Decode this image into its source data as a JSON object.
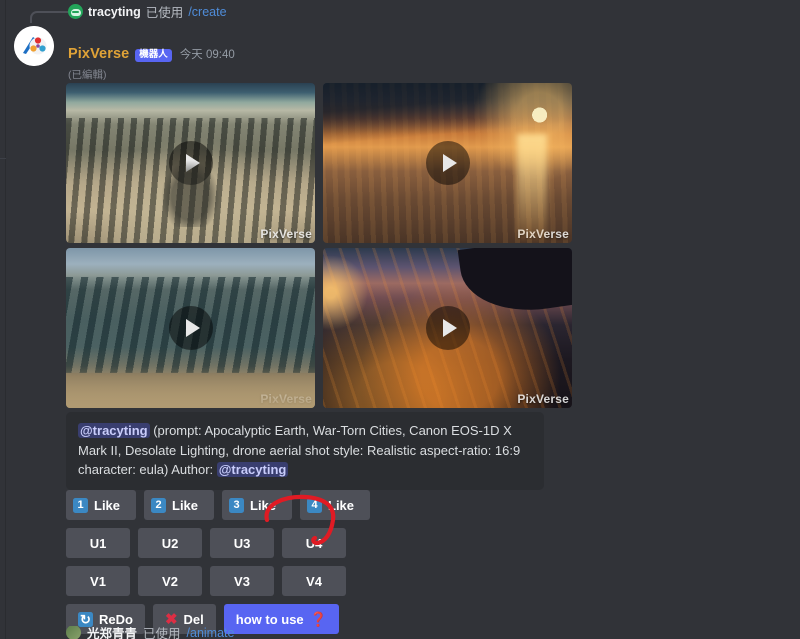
{
  "reply_reference": {
    "avatar_icon": "discord-user-avatar",
    "username": "tracyting",
    "action": "已使用",
    "command": "/create"
  },
  "message": {
    "avatar_icon": "pixverse-logo-avatar",
    "bot_name": "PixVerse",
    "bot_tag": "機器人",
    "timestamp": "今天 09:40",
    "edited_mark": "(已編輯)"
  },
  "media": {
    "play_icon": "play-icon",
    "watermark": "PixVerse",
    "tiles": [
      {
        "alt": "Aerial view of ruined classical city plaza",
        "art": "art1"
      },
      {
        "alt": "Flooded city at fiery orange sunset",
        "art": "art2"
      },
      {
        "alt": "Aerial view of vast destroyed city blocks",
        "art": "art3"
      },
      {
        "alt": "Night aerial of burning city with aircraft wing",
        "art": "art4"
      }
    ]
  },
  "prompt": {
    "mention": "@tracyting",
    "body": " (prompt: Apocalyptic Earth, War-Torn Cities, Canon EOS-1D X Mark II, Desolate Lighting, drone aerial shot style: Realistic aspect-ratio: 16:9 character: eula) Author: ",
    "author_mention": "@tracyting"
  },
  "buttons": {
    "like_row": [
      {
        "badge": "1",
        "label": "Like"
      },
      {
        "badge": "2",
        "label": "Like"
      },
      {
        "badge": "3",
        "label": "Like"
      },
      {
        "badge": "4",
        "label": "Like"
      }
    ],
    "u_row": [
      {
        "label": "U1"
      },
      {
        "label": "U2"
      },
      {
        "label": "U3"
      },
      {
        "label": "U4"
      }
    ],
    "v_row": [
      {
        "label": "V1"
      },
      {
        "label": "V2"
      },
      {
        "label": "V3"
      },
      {
        "label": "V4"
      }
    ],
    "utility_row": {
      "redo_icon": "refresh-icon",
      "redo_label": "ReDo",
      "del_icon": "cross-mark-icon",
      "del_label": "Del",
      "howto_label": "how to use",
      "howto_icon": "question-mark-icon"
    }
  },
  "annotation": {
    "type": "hand-drawn-red-circle",
    "target": "U4",
    "color": "#e01b24"
  },
  "next_message": {
    "avatar_icon": "user-avatar",
    "username": "光郑青青",
    "action": "已使用",
    "command": "/animate"
  },
  "colors": {
    "background": "#313338",
    "quote_background": "#2b2d31",
    "button_secondary": "#4e5058",
    "button_primary": "#5865f2",
    "bot_name": "#e0a337",
    "annotation_red": "#e01b24"
  }
}
